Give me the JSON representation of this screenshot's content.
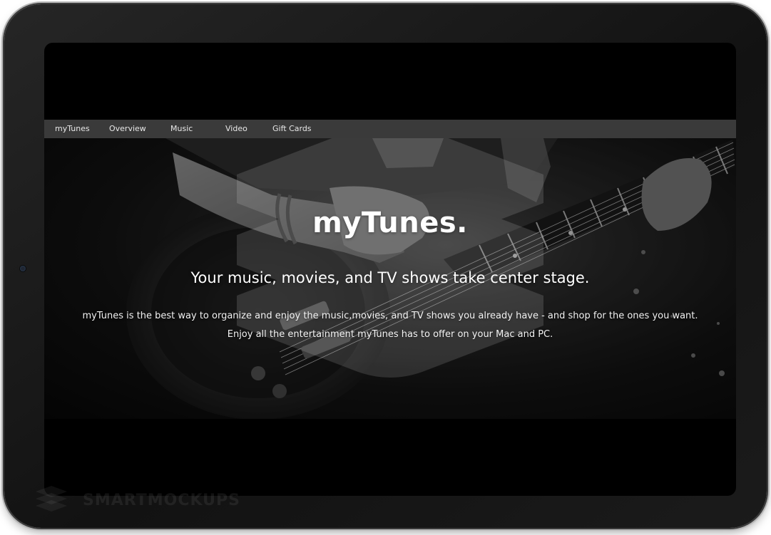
{
  "nav": {
    "items": [
      {
        "label": "myTunes"
      },
      {
        "label": "Overview"
      },
      {
        "label": "Music"
      },
      {
        "label": "Video"
      },
      {
        "label": "Gift Cards"
      }
    ]
  },
  "hero": {
    "title": "myTunes.",
    "tagline": "Your music, movies, and TV shows take center stage.",
    "description_line1": "myTunes is the best way to organize and enjoy the music,movies, and TV shows you already have - and shop for the ones you want.",
    "description_line2": "Enjoy all the entertainment myTunes has to offer on your Mac and PC."
  },
  "watermark": {
    "text": "SMARTMOCKUPS"
  },
  "colors": {
    "navbar": "#3a3a3a",
    "screen_bg": "#000000",
    "device_frame": "#1b1b1b"
  }
}
